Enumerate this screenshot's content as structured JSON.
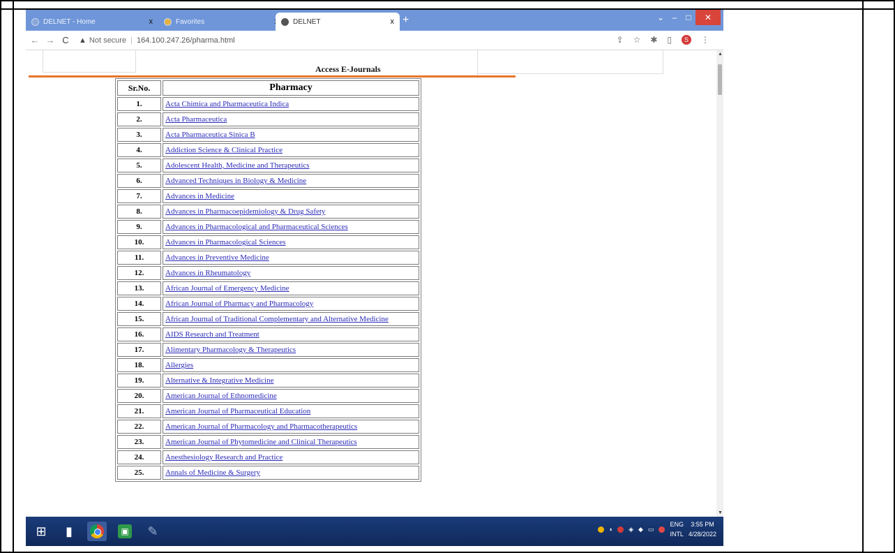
{
  "browser": {
    "tabs": [
      {
        "label": "DELNET - Home",
        "close": "x"
      },
      {
        "label": "Favorites",
        "close": "x"
      },
      {
        "label": "DELNET",
        "close": "x"
      }
    ],
    "new_tab": "+",
    "address": {
      "security": "Not secure",
      "url": "164.100.247.26/pharma.html"
    },
    "profile_initial": "S"
  },
  "page": {
    "heading": "Access E-Journals",
    "table": {
      "col_sr": "Sr.No.",
      "col_name": "Pharmacy",
      "rows": [
        {
          "sr": "1.",
          "name": "Acta Chimica and Pharmaceutica Indica"
        },
        {
          "sr": "2.",
          "name": "Acta Pharmaceutica"
        },
        {
          "sr": "3.",
          "name": "Acta Pharmaceutica Sinica B"
        },
        {
          "sr": "4.",
          "name": "Addiction Science & Clinical Practice"
        },
        {
          "sr": "5.",
          "name": "Adolescent Health, Medicine and Therapeutics"
        },
        {
          "sr": "6.",
          "name": "Advanced Techniques in Biology & Medicine"
        },
        {
          "sr": "7.",
          "name": "Advances in Medicine"
        },
        {
          "sr": "8.",
          "name": "Advances in Pharmacoepidemiology & Drug Safety"
        },
        {
          "sr": "9.",
          "name": "Advances in Pharmacological and Pharmaceutical Sciences"
        },
        {
          "sr": "10.",
          "name": "Advances in Pharmacological Sciences"
        },
        {
          "sr": "11.",
          "name": "Advances in Preventive Medicine"
        },
        {
          "sr": "12.",
          "name": "Advances in Rheumatology"
        },
        {
          "sr": "13.",
          "name": "African Journal of Emergency Medicine"
        },
        {
          "sr": "14.",
          "name": "African Journal of Pharmacy and Pharmacology"
        },
        {
          "sr": "15.",
          "name": "African Journal of Traditional Complementary and Alternative Medicine"
        },
        {
          "sr": "16.",
          "name": "AIDS Research and Treatment"
        },
        {
          "sr": "17.",
          "name": "Alimentary Pharmacology & Therapeutics"
        },
        {
          "sr": "18.",
          "name": "Allergies"
        },
        {
          "sr": "19.",
          "name": "Alternative & Integrative Medicine"
        },
        {
          "sr": "20.",
          "name": "American Journal of Ethnomedicine"
        },
        {
          "sr": "21.",
          "name": "American Journal of Pharmaceutical Education"
        },
        {
          "sr": "22.",
          "name": "American Journal of Pharmacology and Pharmacotherapeutics"
        },
        {
          "sr": "23.",
          "name": "American Journal of Phytomedicine and Clinical Therapeutics"
        },
        {
          "sr": "24.",
          "name": "Anesthesiology Research and Practice"
        },
        {
          "sr": "25.",
          "name": "Annals of Medicine & Surgery"
        }
      ]
    }
  },
  "taskbar": {
    "lang_top": "ENG",
    "lang_bottom": "INTL",
    "time": "3:55 PM",
    "date": "4/28/2022"
  },
  "colors": {
    "tabstrip": "#6f96d8",
    "accent_line": "#e8752c",
    "link": "#2a2ab8",
    "taskbar": "#10295a"
  }
}
